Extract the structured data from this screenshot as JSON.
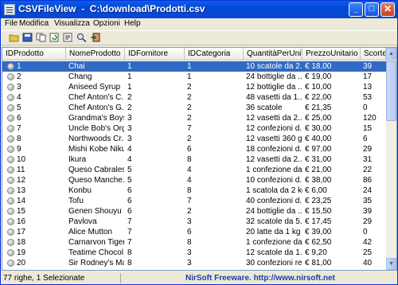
{
  "window": {
    "title": "CSVFileView  -  C:\\download\\Prodotti.csv",
    "minimize": "_",
    "maximize": "□",
    "close": "✕"
  },
  "menu": [
    "File",
    "Modifica",
    "Visualizza",
    "Opzioni",
    "Help"
  ],
  "toolbar": [
    "open-folder-icon",
    "save-icon",
    "copy-icon",
    "refresh-icon",
    "properties-icon",
    "find-icon",
    "exit-icon"
  ],
  "table": {
    "columns": [
      "IDProdotto",
      "NomeProdotto",
      "IDFornitore",
      "IDCategoria",
      "QuantitàPerUnità",
      "PrezzoUnitario",
      "Scorte"
    ],
    "selected_index": 0,
    "rows": [
      [
        "1",
        "Chai",
        "1",
        "1",
        "10 scatole da 2...",
        "€ 18,00",
        "39"
      ],
      [
        "2",
        "Chang",
        "1",
        "1",
        "24 bottiglie da ...",
        "€ 19,00",
        "17"
      ],
      [
        "3",
        "Aniseed Syrup",
        "1",
        "2",
        "12 bottiglie da ...",
        "€ 10,00",
        "13"
      ],
      [
        "4",
        "Chef Anton's C...",
        "2",
        "2",
        "48 vasetti da 1...",
        "€ 22,00",
        "53"
      ],
      [
        "5",
        "Chef Anton's G...",
        "2",
        "2",
        "36 scatole",
        "€ 21,35",
        "0"
      ],
      [
        "6",
        "Grandma's Boys...",
        "3",
        "2",
        "12 vasetti da 2...",
        "€ 25,00",
        "120"
      ],
      [
        "7",
        "Uncle Bob's Org...",
        "3",
        "7",
        "12 confezioni d...",
        "€ 30,00",
        "15"
      ],
      [
        "8",
        "Northwoods Cr...",
        "3",
        "2",
        "12 vasetti 360 g",
        "€ 40,00",
        "6"
      ],
      [
        "9",
        "Mishi Kobe Niku",
        "4",
        "6",
        "18 confezioni d...",
        "€ 97,00",
        "29"
      ],
      [
        "10",
        "Ikura",
        "4",
        "8",
        "12 vasetti da 2...",
        "€ 31,00",
        "31"
      ],
      [
        "11",
        "Queso Cabrales",
        "5",
        "4",
        "1 confezione da...",
        "€ 21,00",
        "22"
      ],
      [
        "12",
        "Queso Manche...",
        "5",
        "4",
        "10 confezioni d...",
        "€ 38,00",
        "86"
      ],
      [
        "13",
        "Konbu",
        "6",
        "8",
        "1 scatola da 2 kg",
        "€ 6,00",
        "24"
      ],
      [
        "14",
        "Tofu",
        "6",
        "7",
        "40 confezioni d...",
        "€ 23,25",
        "35"
      ],
      [
        "15",
        "Genen Shouyu",
        "6",
        "2",
        "24 bottiglie da ...",
        "€ 15,50",
        "39"
      ],
      [
        "16",
        "Pavlova",
        "7",
        "3",
        "32 scatole da 5...",
        "€ 17,45",
        "29"
      ],
      [
        "17",
        "Alice Mutton",
        "7",
        "6",
        "20 latte da 1 kg",
        "€ 39,00",
        "0"
      ],
      [
        "18",
        "Carnarvon Tigers",
        "7",
        "8",
        "1 confezione da...",
        "€ 62,50",
        "42"
      ],
      [
        "19",
        "Teatime Chocol...",
        "8",
        "3",
        "12 scatole da 1...",
        "€ 9,20",
        "25"
      ],
      [
        "20",
        "Sir Rodney's Ma...",
        "8",
        "3",
        "30 confezioni re...",
        "€ 81,00",
        "40"
      ]
    ]
  },
  "status": {
    "count": "77 righe, 1 Selezionate",
    "credit": "NirSoft Freeware.  http://www.nirsoft.net"
  }
}
